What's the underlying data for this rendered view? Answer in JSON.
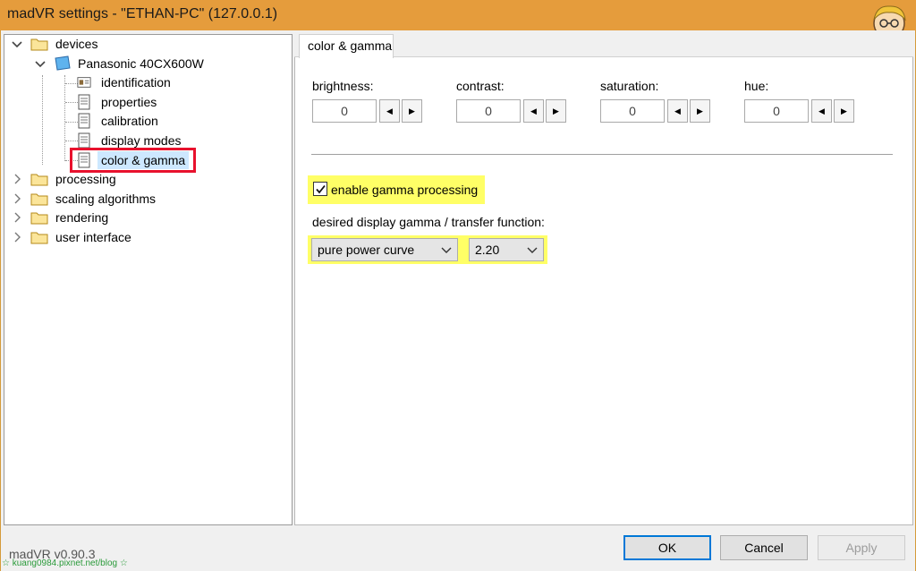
{
  "window": {
    "title": "madVR settings - \"ETHAN-PC\" (127.0.0.1)",
    "version": "madVR v0.90.3",
    "watermark": "☆ kuang0984.pixnet.net/blog ☆"
  },
  "tree": {
    "devices": "devices",
    "device_name": "Panasonic 40CX600W",
    "children": [
      "identification",
      "properties",
      "calibration",
      "display modes",
      "color & gamma"
    ],
    "sections": [
      "processing",
      "scaling algorithms",
      "rendering",
      "user interface"
    ]
  },
  "tab": {
    "label": "color & gamma"
  },
  "controls": {
    "brightness": {
      "label": "brightness:",
      "value": "0"
    },
    "contrast": {
      "label": "contrast:",
      "value": "0"
    },
    "saturation": {
      "label": "saturation:",
      "value": "0"
    },
    "hue": {
      "label": "hue:",
      "value": "0"
    }
  },
  "gamma": {
    "enable_label": "enable gamma processing",
    "enabled": true,
    "desired_label": "desired display gamma / transfer function:",
    "curve": "pure power curve",
    "value": "2.20"
  },
  "buttons": {
    "ok": "OK",
    "cancel": "Cancel",
    "apply": "Apply"
  },
  "colors": {
    "titlebar": "#e59c3c",
    "highlight": "#ffff66",
    "selection_box": "#e8112d",
    "focus": "#0078d7"
  }
}
